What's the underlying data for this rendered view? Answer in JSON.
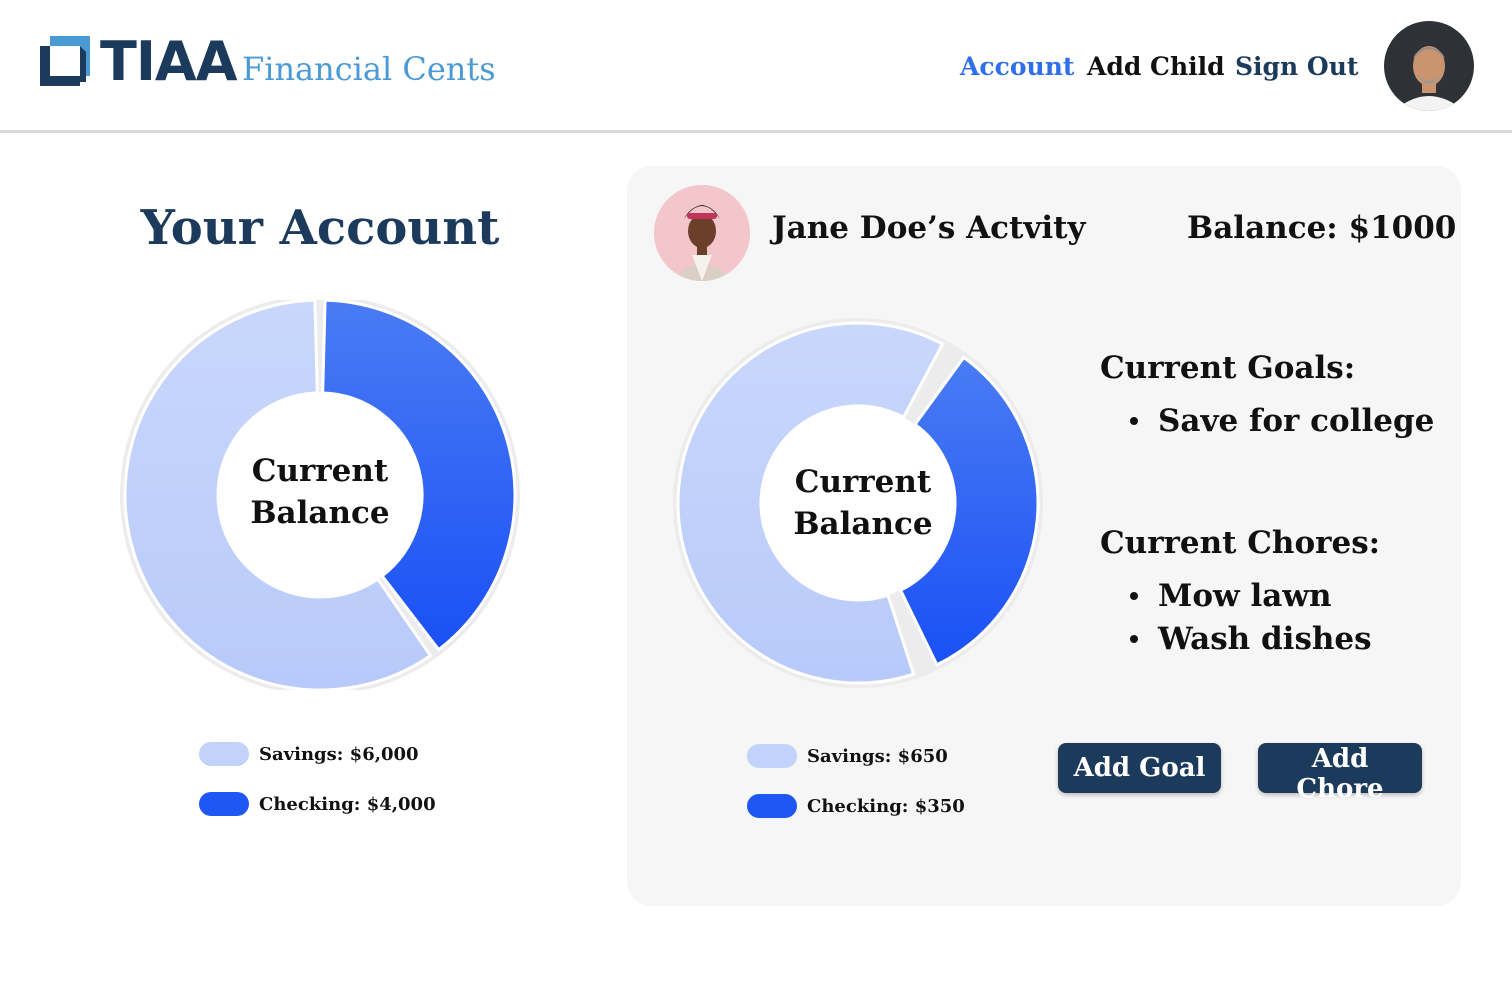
{
  "header": {
    "brand": "TIAA",
    "app_name": "Financial Cents",
    "nav": {
      "account": "Account",
      "add_child": "Add Child",
      "sign_out": "Sign Out"
    }
  },
  "your_account": {
    "title": "Your Account",
    "center_label_line1": "Current",
    "center_label_line2": "Balance",
    "legend": [
      {
        "label": "Savings: $6,000",
        "color": "#c2d3fb"
      },
      {
        "label": "Checking: $4,000",
        "color": "#1e57f3"
      }
    ]
  },
  "child": {
    "name": "Jane Doe’s Actvity",
    "balance": "Balance: $1000",
    "center_label_line1": "Current",
    "center_label_line2": "Balance",
    "legend": [
      {
        "label": "Savings: $650",
        "color": "#c2d3fb"
      },
      {
        "label": "Checking: $350",
        "color": "#1e57f3"
      }
    ],
    "goals_heading": "Current Goals:",
    "goals": [
      "Save for college"
    ],
    "chores_heading": "Current Chores:",
    "chores": [
      "Mow lawn",
      "Wash dishes"
    ],
    "add_goal": "Add Goal",
    "add_chore": "Add Chore"
  },
  "chart_data": [
    {
      "type": "pie",
      "categories": [
        "Savings",
        "Checking"
      ],
      "values": [
        6000,
        4000
      ],
      "title": "",
      "colors": [
        "#c2d3fb",
        "#1e57f3"
      ]
    },
    {
      "type": "pie",
      "categories": [
        "Savings",
        "Checking"
      ],
      "values": [
        650,
        350
      ],
      "title": "",
      "colors": [
        "#c2d3fb",
        "#1e57f3"
      ]
    }
  ]
}
